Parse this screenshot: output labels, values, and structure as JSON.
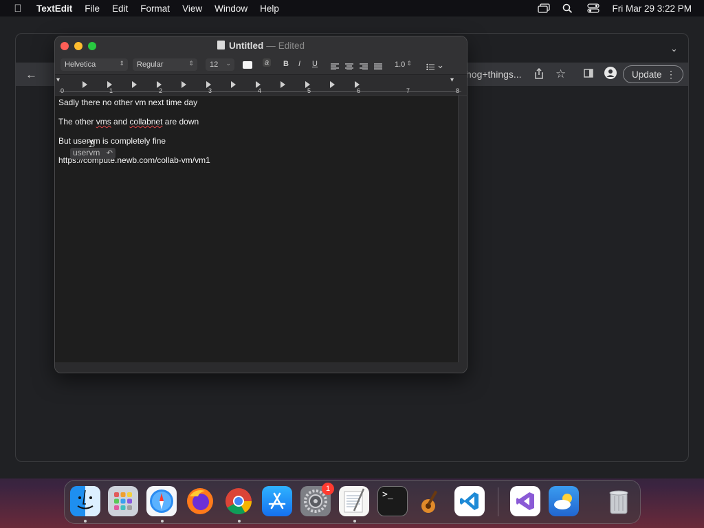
{
  "menubar": {
    "app_name": "TextEdit",
    "menus": [
      "File",
      "Edit",
      "Format",
      "View",
      "Window",
      "Help"
    ],
    "datetime": "Fri Mar 29  3:22 PM"
  },
  "browser": {
    "url_fragment": "hog+things...",
    "update_label": "Update"
  },
  "textedit": {
    "title": "Untitled",
    "title_separator": "—",
    "status": "Edited",
    "toolbar": {
      "font_family": "Helvetica",
      "font_style": "Regular",
      "font_size": "12",
      "bold": "B",
      "italic": "I",
      "underline": "U",
      "line_spacing": "1.0"
    },
    "ruler_numbers": [
      "0",
      "1",
      "2",
      "3",
      "4",
      "5",
      "6",
      "7",
      "8"
    ],
    "lines": [
      "Sadly there no other vm next time day",
      "The other vms and collabnet are down",
      "But uservm is completely fine",
      "https://compute.newb.com/collab-vm/vm1"
    ],
    "line2_parts": {
      "before": "The other ",
      "word1": "vms",
      "mid": " and ",
      "word2": "collabnet",
      "after": " are down"
    },
    "autocorrect_suggestion": "uservm"
  },
  "dock": {
    "apps": [
      "Finder",
      "Launchpad",
      "Safari",
      "Firefox",
      "Chrome",
      "App Store",
      "System Settings",
      "TextEdit",
      "Terminal",
      "GarageBand",
      "Visual Studio Code",
      "Visual Studio",
      "Weather",
      "Trash"
    ],
    "settings_badge": "1"
  }
}
